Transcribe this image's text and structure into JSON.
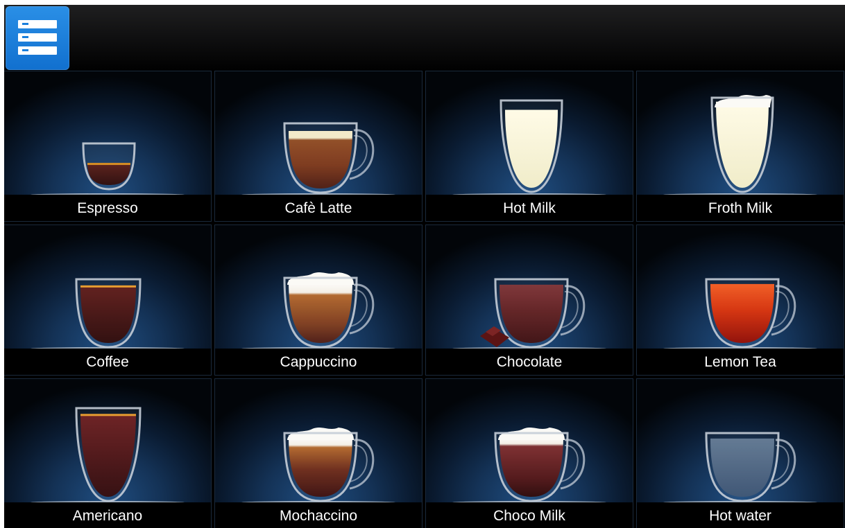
{
  "menu_button": {
    "icon": "list-menu-icon",
    "color": "#1a7fdc"
  },
  "beverages": [
    {
      "label": "Espresso",
      "icon": "espresso-cup-icon"
    },
    {
      "label": "Cafè Latte",
      "icon": "cafe-latte-cup-icon"
    },
    {
      "label": "Hot Milk",
      "icon": "hot-milk-glass-icon"
    },
    {
      "label": "Froth Milk",
      "icon": "froth-milk-glass-icon"
    },
    {
      "label": "Coffee",
      "icon": "coffee-cup-icon"
    },
    {
      "label": "Cappuccino",
      "icon": "cappuccino-cup-icon"
    },
    {
      "label": "Chocolate",
      "icon": "chocolate-cup-icon"
    },
    {
      "label": "Lemon Tea",
      "icon": "lemon-tea-cup-icon"
    },
    {
      "label": "Americano",
      "icon": "americano-glass-icon"
    },
    {
      "label": "Mochaccino",
      "icon": "mochaccino-cup-icon"
    },
    {
      "label": "Choco Milk",
      "icon": "choco-milk-cup-icon"
    },
    {
      "label": "Hot water",
      "icon": "hot-water-cup-icon"
    }
  ]
}
